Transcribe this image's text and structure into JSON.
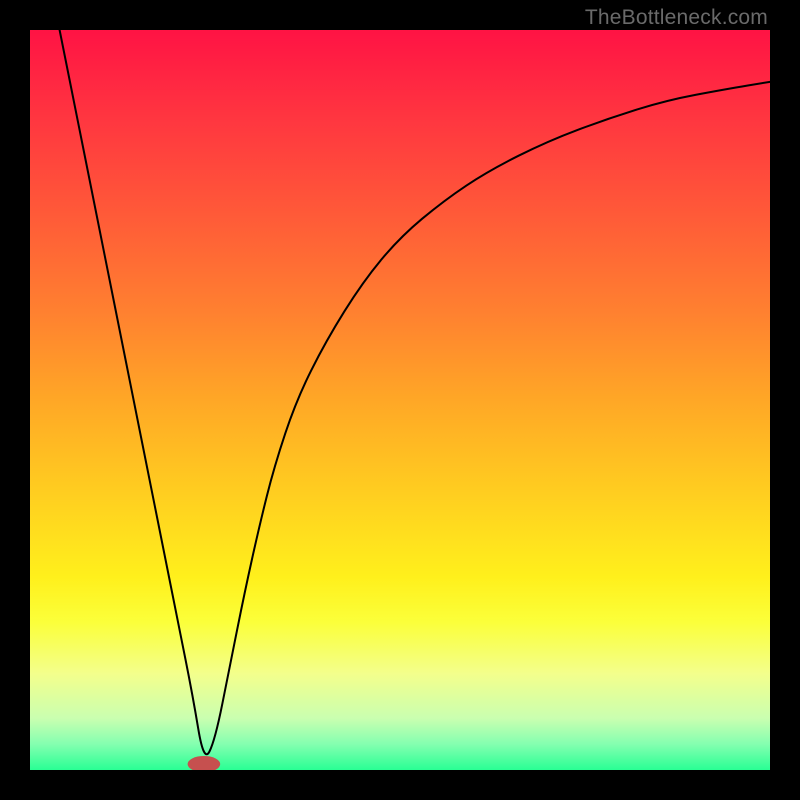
{
  "watermark": "TheBottleneck.com",
  "chart_data": {
    "type": "line",
    "title": "",
    "xlabel": "",
    "ylabel": "",
    "xlim": [
      0,
      100
    ],
    "ylim": [
      0,
      100
    ],
    "grid": false,
    "legend": false,
    "annotations": [],
    "background_gradient": {
      "stops": [
        {
          "offset": 0.0,
          "color": "#ff1344"
        },
        {
          "offset": 0.12,
          "color": "#ff3640"
        },
        {
          "offset": 0.25,
          "color": "#ff5a38"
        },
        {
          "offset": 0.38,
          "color": "#ff8030"
        },
        {
          "offset": 0.5,
          "color": "#ffa726"
        },
        {
          "offset": 0.62,
          "color": "#ffcc20"
        },
        {
          "offset": 0.74,
          "color": "#fff01c"
        },
        {
          "offset": 0.8,
          "color": "#fbff3a"
        },
        {
          "offset": 0.87,
          "color": "#f3ff8c"
        },
        {
          "offset": 0.93,
          "color": "#caffb0"
        },
        {
          "offset": 0.965,
          "color": "#84ffb0"
        },
        {
          "offset": 1.0,
          "color": "#29ff94"
        }
      ]
    },
    "series": [
      {
        "name": "bottleneck-curve",
        "color": "#000000",
        "stroke_width": 2,
        "x": [
          4,
          6,
          8,
          10,
          12,
          14,
          16,
          18,
          20,
          22,
          23.5,
          25,
          27,
          29,
          31,
          33,
          36,
          40,
          45,
          50,
          56,
          62,
          70,
          78,
          86,
          94,
          100
        ],
        "y": [
          100,
          90,
          80,
          70,
          60,
          50,
          40,
          30,
          20,
          10,
          1,
          4,
          14,
          24,
          33,
          41,
          50,
          58,
          66,
          72,
          77,
          81,
          85,
          88,
          90.5,
          92,
          93
        ]
      }
    ],
    "marker": {
      "name": "optimum-point",
      "x": 23.5,
      "y": 0.8,
      "rx": 2.2,
      "ry": 1.1,
      "color": "#c6504f"
    }
  }
}
